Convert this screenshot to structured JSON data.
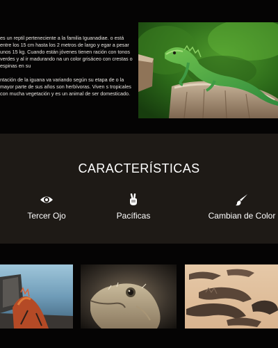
{
  "intro": {
    "paragraph_1": "es un reptil perteneciente a la familia Iguanadiae. o está entre los 15 cm hasta los 2 metros de largo y egar a pesar unos 15 kg. Cuando están jóvenes tienen ración con tonos verdes y al ir madurando na un color grisáceo con crestas o espinas en su",
    "paragraph_2": "ntación de la iguana va variando según su etapa de o la mayor parte de sus años son herbívoras. Viven s tropicales con mucha vegetación y es un animal de ser domesticado."
  },
  "features": {
    "title": "CARACTERÍSTICAS",
    "items": [
      {
        "label": "Tercer Ojo",
        "icon": "eye-icon"
      },
      {
        "label": "Pacíficas",
        "icon": "peace-hand-icon"
      },
      {
        "label": "Cambian de Color",
        "icon": "paint-brush-icon"
      }
    ]
  },
  "gallery": {
    "images": [
      {
        "icon": "marine-iguana-photo"
      },
      {
        "icon": "iguana-head-photo"
      },
      {
        "icon": "iguanas-on-beach-photo"
      }
    ]
  },
  "colors": {
    "page_bg": "#050404",
    "features_bg": "#1e1a16",
    "text": "#ffffff"
  }
}
